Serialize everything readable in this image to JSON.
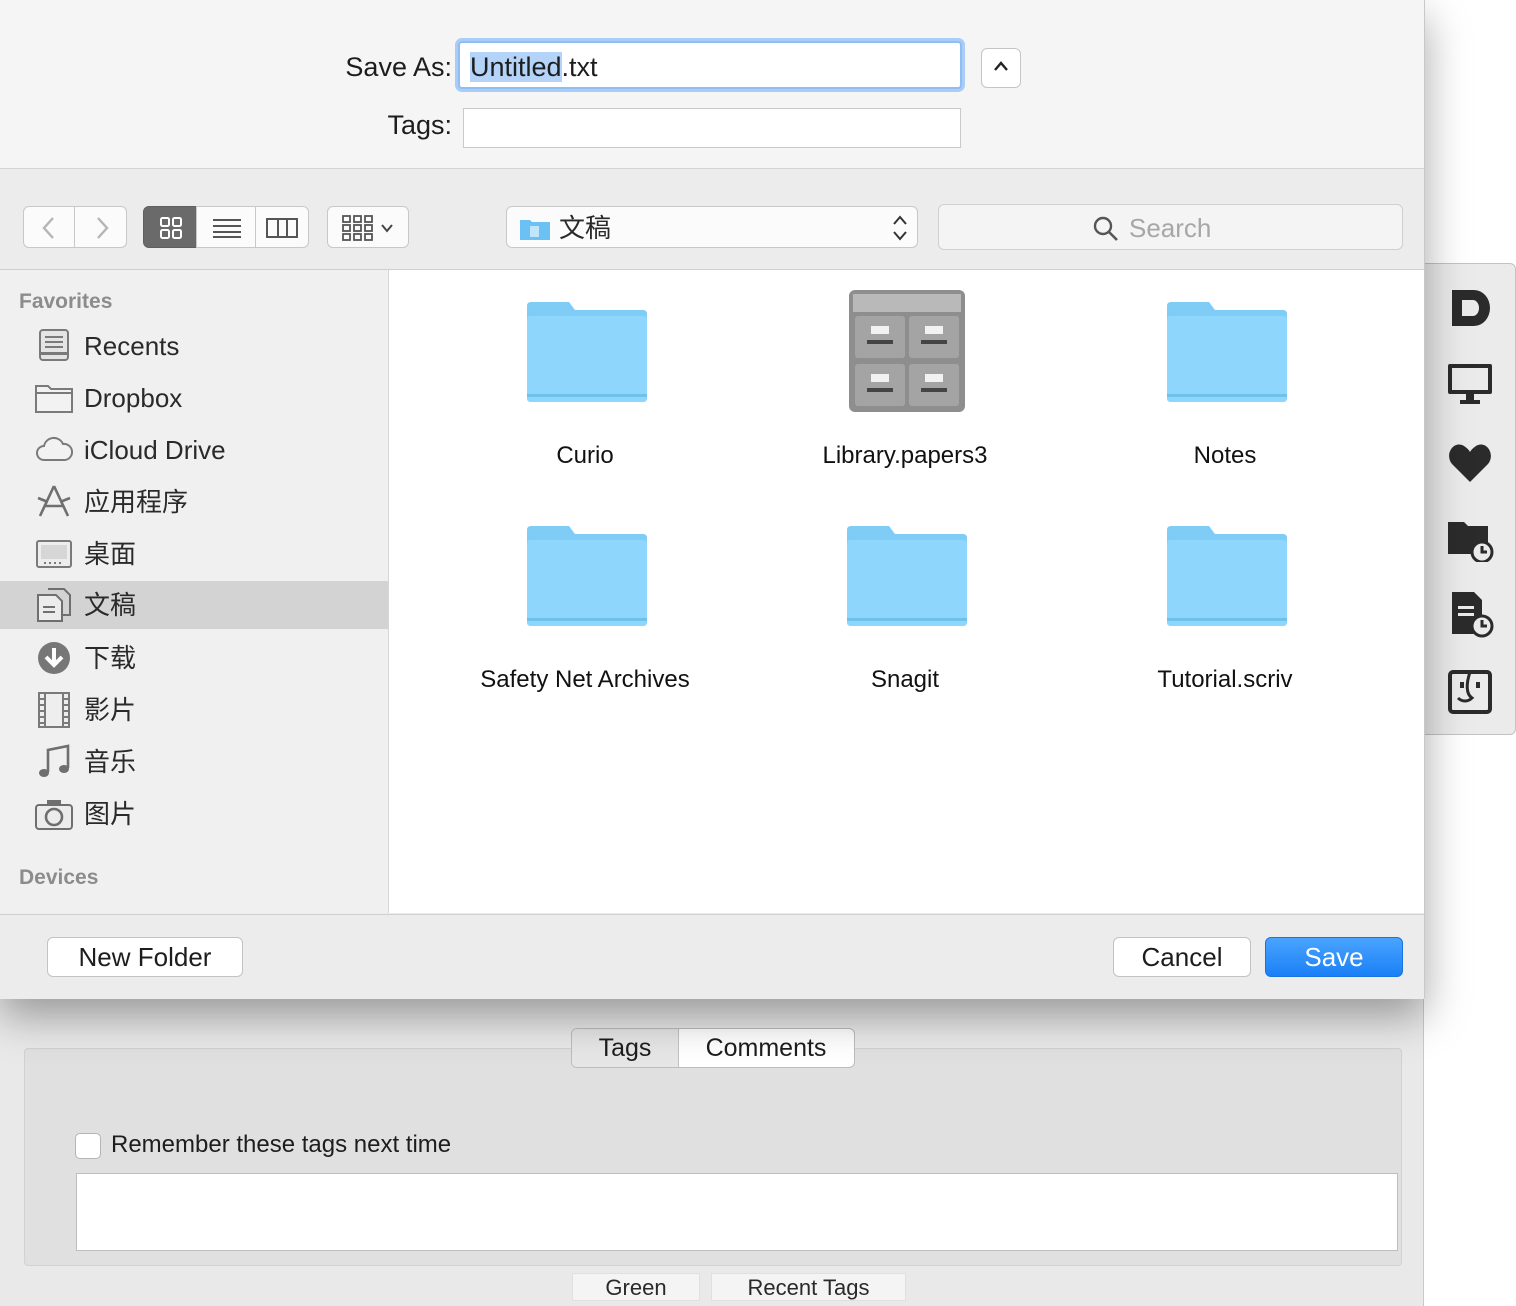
{
  "save_form": {
    "save_as_label": "Save As:",
    "filename_selected": "Untitled",
    "filename_rest": ".txt",
    "tags_label": "Tags:"
  },
  "toolbar": {
    "current_folder": "文稿",
    "search_placeholder": "Search"
  },
  "sidebar": {
    "favorites_header": "Favorites",
    "devices_header": "Devices",
    "items": [
      {
        "label": "Recents",
        "icon": "recents-icon"
      },
      {
        "label": "Dropbox",
        "icon": "folder-icon"
      },
      {
        "label": "iCloud Drive",
        "icon": "cloud-icon"
      },
      {
        "label": "应用程序",
        "icon": "applications-icon"
      },
      {
        "label": "桌面",
        "icon": "desktop-icon"
      },
      {
        "label": "文稿",
        "icon": "documents-icon",
        "selected": true
      },
      {
        "label": "下载",
        "icon": "download-icon"
      },
      {
        "label": "影片",
        "icon": "film-icon"
      },
      {
        "label": "音乐",
        "icon": "music-icon"
      },
      {
        "label": "图片",
        "icon": "camera-icon"
      }
    ]
  },
  "files": [
    {
      "name": "Curio",
      "icon": "folder-icon"
    },
    {
      "name": "Library.papers3",
      "icon": "cabinet-icon"
    },
    {
      "name": "Notes",
      "icon": "folder-icon"
    },
    {
      "name": "Safety Net Archives",
      "icon": "folder-icon"
    },
    {
      "name": "Snagit",
      "icon": "folder-icon"
    },
    {
      "name": "Tutorial.scriv",
      "icon": "folder-icon"
    }
  ],
  "buttons": {
    "new_folder": "New Folder",
    "cancel": "Cancel",
    "save": "Save"
  },
  "panel": {
    "tab_tags": "Tags",
    "tab_comments": "Comments",
    "remember_label": "Remember these tags next time",
    "green": "Green",
    "recent_tags": "Recent Tags"
  },
  "colors": {
    "accent": "#1a80f6",
    "folder": "#7fcdf7",
    "selection": "#b3d3f8"
  }
}
